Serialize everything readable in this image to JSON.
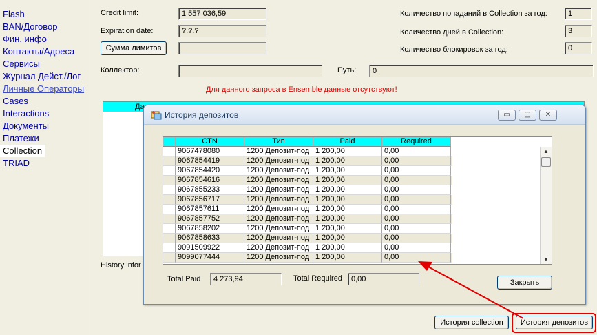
{
  "sidebar": {
    "items": [
      {
        "label": "Flash"
      },
      {
        "label": "BAN/Договор"
      },
      {
        "label": "Фин. инфо"
      },
      {
        "label": "Контакты/Адреса"
      },
      {
        "label": "Сервисы"
      },
      {
        "label": "Журнал Дейст./Лог"
      },
      {
        "label": "Личные Операторы"
      },
      {
        "label": "Cases"
      },
      {
        "label": "Interactions"
      },
      {
        "label": "Документы"
      },
      {
        "label": "Платежи"
      },
      {
        "label": "Collection"
      },
      {
        "label": "TRIAD"
      }
    ],
    "active": "Collection"
  },
  "main": {
    "credit_limit_label": "Credit limit:",
    "credit_limit_value": "1 557 036,59",
    "expiration_label": "Expiration date:",
    "expiration_value": "?.?.?",
    "limits_button": "Сумма лимитов",
    "limits_value": "",
    "hits_label": "Количество попаданий в Collection за год:",
    "hits_value": "1",
    "days_label": "Количество дней в Collection:",
    "days_value": "3",
    "blocks_label": "Количество блокировок за год:",
    "blocks_value": "0",
    "collector_label": "Коллектор:",
    "collector_value": "",
    "path_label": "Путь:",
    "path_value": "0",
    "ensemble_message": "Для данного запроса в Ensemble данные отсутствуют!",
    "grid_header_partial": "Да",
    "history_info_partial": "History infor",
    "history_collection_button": "История collection",
    "history_deposits_button": "История депозитов"
  },
  "dialog": {
    "title": "История депозитов",
    "minimize_glyph": "▭",
    "maximize_glyph": "▢",
    "close_glyph": "✕",
    "columns": [
      "CTN",
      "Тип",
      "Paid",
      "Required"
    ],
    "rows": [
      [
        "9067478080",
        "1200 Депозит-под",
        "1 200,00",
        "0,00"
      ],
      [
        "9067854419",
        "1200 Депозит-под",
        "1 200,00",
        "0,00"
      ],
      [
        "9067854420",
        "1200 Депозит-под",
        "1 200,00",
        "0,00"
      ],
      [
        "9067854616",
        "1200 Депозит-под",
        "1 200,00",
        "0,00"
      ],
      [
        "9067855233",
        "1200 Депозит-под",
        "1 200,00",
        "0,00"
      ],
      [
        "9067856717",
        "1200 Депозит-под",
        "1 200,00",
        "0,00"
      ],
      [
        "9067857611",
        "1200 Депозит-под",
        "1 200,00",
        "0,00"
      ],
      [
        "9067857752",
        "1200 Депозит-под",
        "1 200,00",
        "0,00"
      ],
      [
        "9067858202",
        "1200 Депозит-под",
        "1 200,00",
        "0,00"
      ],
      [
        "9067858633",
        "1200 Депозит-под",
        "1 200,00",
        "0,00"
      ],
      [
        "9091509922",
        "1200 Депозит-под",
        "1 200,00",
        "0,00"
      ],
      [
        "9099077444",
        "1200 Депозит-под",
        "1 200,00",
        "0,00"
      ]
    ],
    "total_paid_label": "Total Paid",
    "total_paid_value": "4 273,94",
    "total_required_label": "Total Required",
    "total_required_value": "0,00",
    "close_button": "Закрыть"
  },
  "colors": {
    "accent_cyan": "#00ffff",
    "alert_red": "#e00000",
    "panel_bg": "#ece9d8"
  }
}
